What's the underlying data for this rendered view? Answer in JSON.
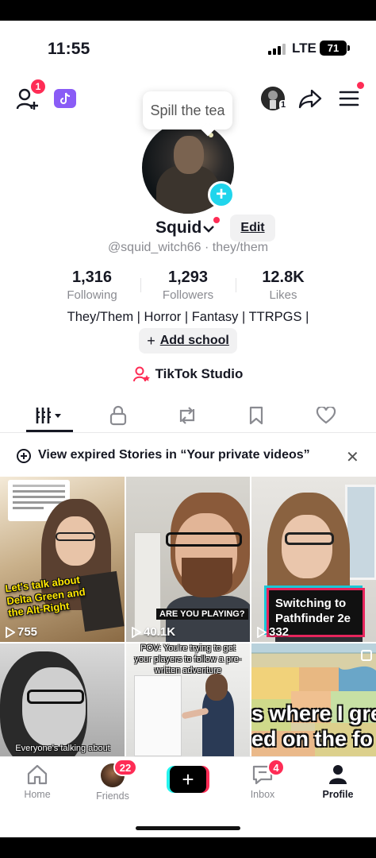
{
  "status_bar": {
    "time": "11:55",
    "network": "LTE",
    "battery": "71"
  },
  "header": {
    "add_friends_badge": "1",
    "tooltip": "Spill the tea",
    "account_badge": "1"
  },
  "profile": {
    "name": "Squid",
    "edit_label": "Edit",
    "handle": "@squid_witch66 · they/them",
    "stats": [
      {
        "value": "1,316",
        "label": "Following"
      },
      {
        "value": "1,293",
        "label": "Followers"
      },
      {
        "value": "12.8K",
        "label": "Likes"
      }
    ],
    "bio": "They/Them | Horror | Fantasy | TTRPGS |",
    "add_school": "Add school",
    "studio": "TikTok Studio"
  },
  "banner": {
    "text": "View expired Stories in “Your private videos”"
  },
  "videos": [
    {
      "caption": "Let's talk about Delta Green and the Alt-Right",
      "views": "755"
    },
    {
      "caption": "ARE YOU PLAYING?",
      "views": "40.1K"
    },
    {
      "caption": "Switching to Pathfinder 2e",
      "views": "332"
    },
    {
      "caption": "Everyone's talking about"
    },
    {
      "caption": "POV: You're trying to get your players to follow a pre-written adventure"
    },
    {
      "caption_line1": "s where I gre",
      "caption_line2": "ed on the fo"
    }
  ],
  "bottom_nav": {
    "home": "Home",
    "friends": "Friends",
    "friends_badge": "22",
    "inbox": "Inbox",
    "inbox_badge": "4",
    "profile": "Profile"
  },
  "colors": {
    "accent": "#fe2c55",
    "cyan": "#25f4ee",
    "text": "#161823",
    "muted": "#8a8b91"
  }
}
